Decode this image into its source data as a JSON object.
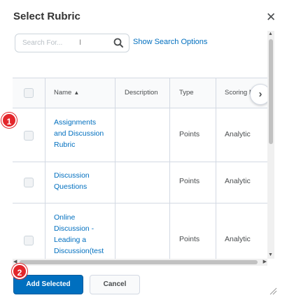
{
  "dialog": {
    "title": "Select Rubric",
    "close_icon": "close-icon"
  },
  "search": {
    "placeholder": "Search For...",
    "options_link": "Show Search Options"
  },
  "table": {
    "headers": [
      "Name",
      "Description",
      "Type",
      "Scoring M"
    ],
    "rows": [
      {
        "name_lines": [
          "Assignments",
          "and Discussion",
          "Rubric"
        ],
        "description": "",
        "type": "Points",
        "scoring": "Analytic"
      },
      {
        "name_lines": [
          "Discussion",
          "Questions"
        ],
        "description": "",
        "type": "Points",
        "scoring": "Analytic"
      },
      {
        "name_lines": [
          "Online",
          "Discussion -",
          "Leading a",
          "Discussion(test"
        ],
        "description": "",
        "type": "Points",
        "scoring": "Analytic"
      }
    ]
  },
  "buttons": {
    "add_selected": "Add Selected",
    "cancel": "Cancel"
  },
  "callouts": [
    "1",
    "2"
  ],
  "colors": {
    "accent": "#006fbf",
    "callout": "#e3262b"
  }
}
